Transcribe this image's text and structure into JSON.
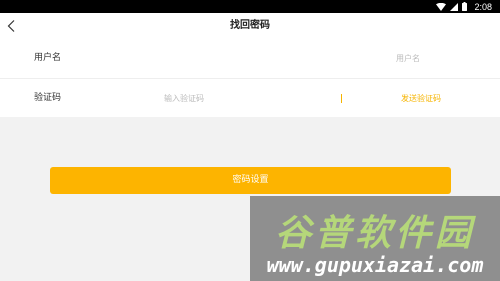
{
  "status_bar": {
    "time": "2:08",
    "icons": [
      "wifi-icon",
      "signal-icon",
      "battery-icon"
    ]
  },
  "header": {
    "back_icon": "chevron-left-icon",
    "title": "找回密码"
  },
  "form": {
    "username": {
      "label": "用户名",
      "placeholder": "用户名"
    },
    "code": {
      "label": "验证码",
      "placeholder": "输入验证码",
      "send_label": "发送验证码"
    }
  },
  "submit_label": "密码设置",
  "watermark": {
    "title": "谷普软件园",
    "url": "www.gupuxiazai.com"
  },
  "colors": {
    "accent": "#fdb400",
    "accent_text": "#f6b400",
    "status_bar": "#000000",
    "background": "#f2f2f2",
    "watermark_green": "#b5d77a"
  }
}
